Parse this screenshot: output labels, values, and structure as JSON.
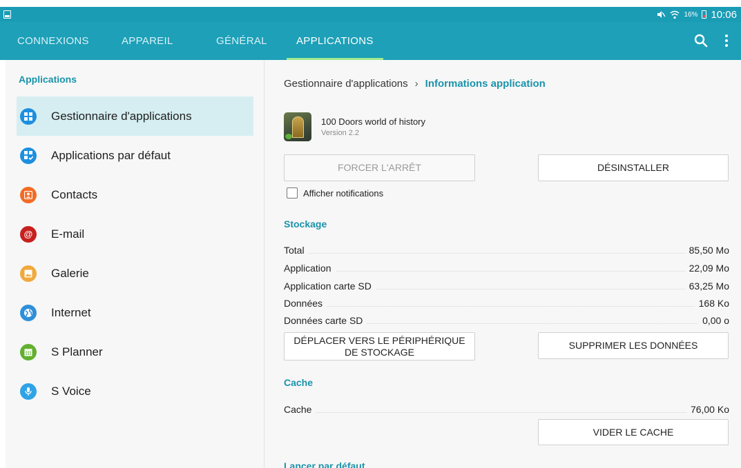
{
  "status_bar": {
    "battery_percent": "16%",
    "time": "10:06"
  },
  "tabs": [
    {
      "label": "CONNEXIONS"
    },
    {
      "label": "APPAREIL"
    },
    {
      "label": "GÉNÉRAL"
    },
    {
      "label": "APPLICATIONS"
    }
  ],
  "active_tab": "APPLICATIONS",
  "sidebar": {
    "header": "Applications",
    "items": [
      {
        "label": "Gestionnaire d'applications",
        "icon": "grid-icon",
        "color": "#1e8fe0",
        "selected": true
      },
      {
        "label": "Applications par défaut",
        "icon": "apps-check-icon",
        "color": "#1e8fe0"
      },
      {
        "label": "Contacts",
        "icon": "contact-icon",
        "color": "#f26c25"
      },
      {
        "label": "E-mail",
        "icon": "at-icon",
        "color": "#c8201d"
      },
      {
        "label": "Galerie",
        "icon": "gallery-icon",
        "color": "#f0a93b"
      },
      {
        "label": "Internet",
        "icon": "globe-icon",
        "color": "#2f8fd8"
      },
      {
        "label": "S Planner",
        "icon": "calendar-icon",
        "color": "#63b030"
      },
      {
        "label": "S Voice",
        "icon": "mic-icon",
        "color": "#2fa3e6"
      }
    ]
  },
  "breadcrumb": {
    "parent": "Gestionnaire d'applications",
    "current": "Informations application"
  },
  "app": {
    "name": "100 Doors world of history",
    "version": "Version 2.2"
  },
  "buttons": {
    "force_stop": "FORCER L'ARRÊT",
    "uninstall": "DÉSINSTALLER",
    "move_storage": "DÉPLACER VERS LE PÉRIPHÉRIQUE DE STOCKAGE",
    "clear_data": "SUPPRIMER LES DONNÉES",
    "clear_cache": "VIDER LE CACHE"
  },
  "notifications_checkbox": {
    "label": "Afficher notifications",
    "checked": false
  },
  "storage": {
    "title": "Stockage",
    "rows": [
      {
        "label": "Total",
        "value": "85,50 Mo"
      },
      {
        "label": "Application",
        "value": "22,09 Mo"
      },
      {
        "label": "Application carte SD",
        "value": "63,25 Mo"
      },
      {
        "label": "Données",
        "value": "168 Ko"
      },
      {
        "label": "Données carte SD",
        "value": "0,00 o"
      }
    ]
  },
  "cache": {
    "title": "Cache",
    "label": "Cache",
    "value": "76,00 Ko"
  },
  "launch_default": {
    "title": "Lancer par défaut"
  },
  "colors": {
    "accent": "#1da0b8",
    "tab_indicator": "#9fe98f",
    "section_title": "#1a93ab"
  }
}
